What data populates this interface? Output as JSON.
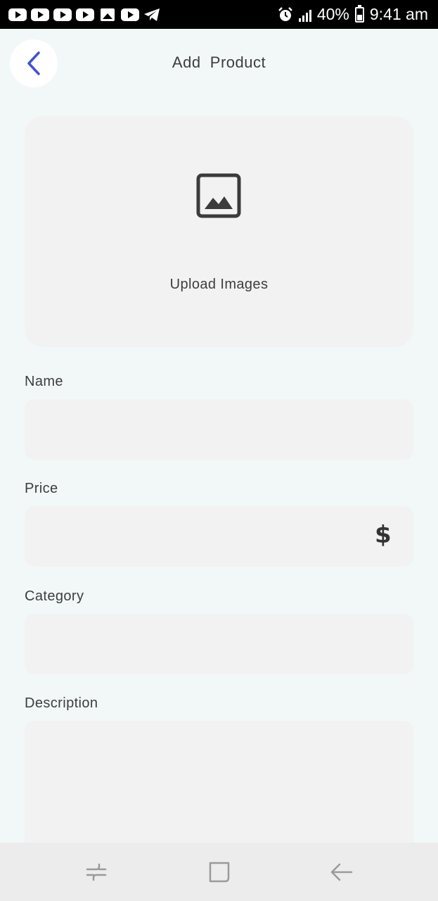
{
  "status_bar": {
    "battery": "40%",
    "time": "9:41 am",
    "notification_icons": [
      "youtube-icon",
      "youtube-icon",
      "youtube-icon",
      "youtube-icon",
      "gallery-icon",
      "youtube-icon",
      "telegram-icon"
    ]
  },
  "header": {
    "title": "Add  Product",
    "accent_color": "#3f51d6"
  },
  "upload": {
    "label": "Upload Images",
    "icon": "image-icon"
  },
  "form": {
    "name": {
      "label": "Name",
      "value": ""
    },
    "price": {
      "label": "Price",
      "value": "",
      "suffix": "$"
    },
    "category": {
      "label": "Category",
      "value": ""
    },
    "description": {
      "label": "Description",
      "value": ""
    }
  },
  "nav_bar": {
    "buttons": [
      "recent-apps-icon",
      "home-icon",
      "back-icon"
    ]
  }
}
